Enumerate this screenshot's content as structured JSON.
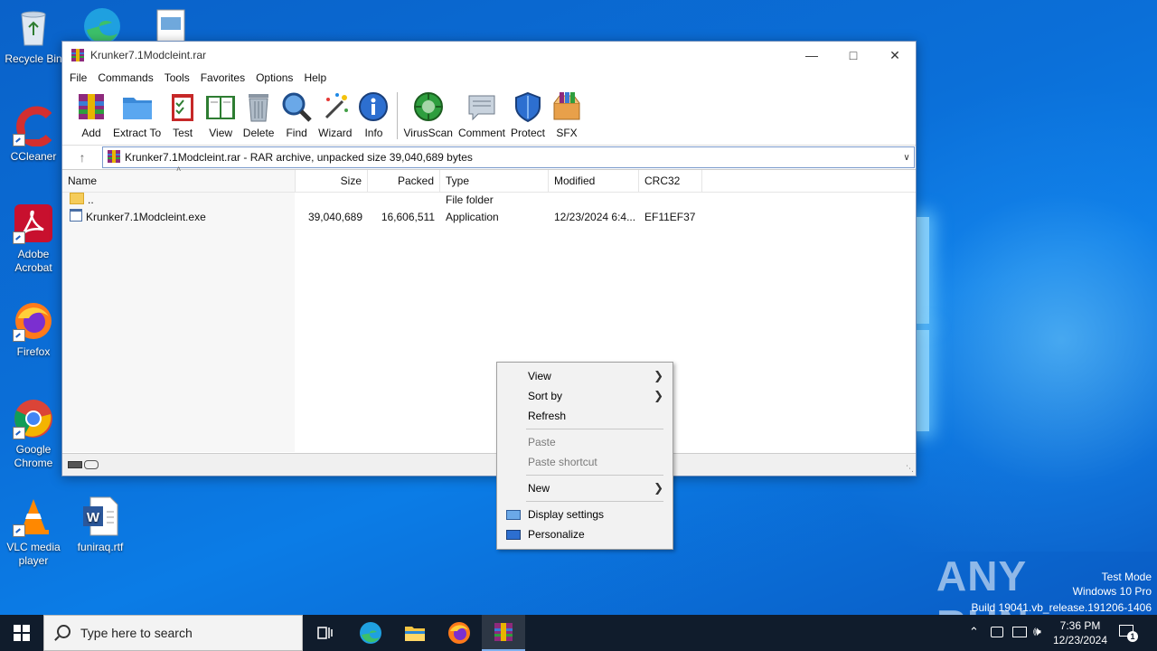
{
  "desktop": {
    "icons": [
      {
        "label": "Recycle Bin"
      },
      {
        "label": "CCleaner"
      },
      {
        "label": "Adobe Acrobat"
      },
      {
        "label": "Firefox"
      },
      {
        "label": "Google Chrome"
      },
      {
        "label": "VLC media player"
      },
      {
        "label": "funiraq.rtf"
      }
    ]
  },
  "window": {
    "title": "Krunker7.1Modcleint.rar",
    "menu": [
      "File",
      "Commands",
      "Tools",
      "Favorites",
      "Options",
      "Help"
    ],
    "toolbar": [
      {
        "label": "Add",
        "icon": "add-archive-icon"
      },
      {
        "label": "Extract To",
        "icon": "extract-folder-icon"
      },
      {
        "label": "Test",
        "icon": "test-clipboard-icon"
      },
      {
        "label": "View",
        "icon": "view-book-icon"
      },
      {
        "label": "Delete",
        "icon": "trash-icon"
      },
      {
        "label": "Find",
        "icon": "magnifier-icon"
      },
      {
        "label": "Wizard",
        "icon": "wand-icon"
      },
      {
        "label": "Info",
        "icon": "info-icon"
      },
      {
        "label": "VirusScan",
        "icon": "virus-scan-icon"
      },
      {
        "label": "Comment",
        "icon": "comment-icon"
      },
      {
        "label": "Protect",
        "icon": "shield-icon"
      },
      {
        "label": "SFX",
        "icon": "sfx-box-icon"
      }
    ],
    "address": "Krunker7.1Modcleint.rar - RAR archive, unpacked size 39,040,689 bytes",
    "columns": [
      "Name",
      "Size",
      "Packed",
      "Type",
      "Modified",
      "CRC32"
    ],
    "rows": [
      {
        "name": "..",
        "size": "",
        "packed": "",
        "type": "File folder",
        "modified": "",
        "crc": ""
      },
      {
        "name": "Krunker7.1Modcleint.exe",
        "size": "39,040,689",
        "packed": "16,606,511",
        "type": "Application",
        "modified": "12/23/2024 6:4...",
        "crc": "EF11EF37"
      }
    ]
  },
  "context_menu": {
    "items": [
      {
        "label": "View",
        "submenu": true,
        "enabled": true
      },
      {
        "label": "Sort by",
        "submenu": true,
        "enabled": true
      },
      {
        "label": "Refresh",
        "enabled": true
      },
      {
        "label": "Paste",
        "enabled": false
      },
      {
        "label": "Paste shortcut",
        "enabled": false
      },
      {
        "label": "New",
        "submenu": true,
        "enabled": true
      },
      {
        "label": "Display settings",
        "enabled": true
      },
      {
        "label": "Personalize",
        "enabled": true
      }
    ]
  },
  "taskbar": {
    "search_placeholder": "Type here to search",
    "time": "7:36 PM",
    "date": "12/23/2024",
    "notification_count": "1"
  },
  "watermark": {
    "brand": "ANY RUN",
    "line1": "Test Mode",
    "line2": "Windows 10 Pro",
    "line3": "Build 19041.vb_release.191206-1406"
  }
}
